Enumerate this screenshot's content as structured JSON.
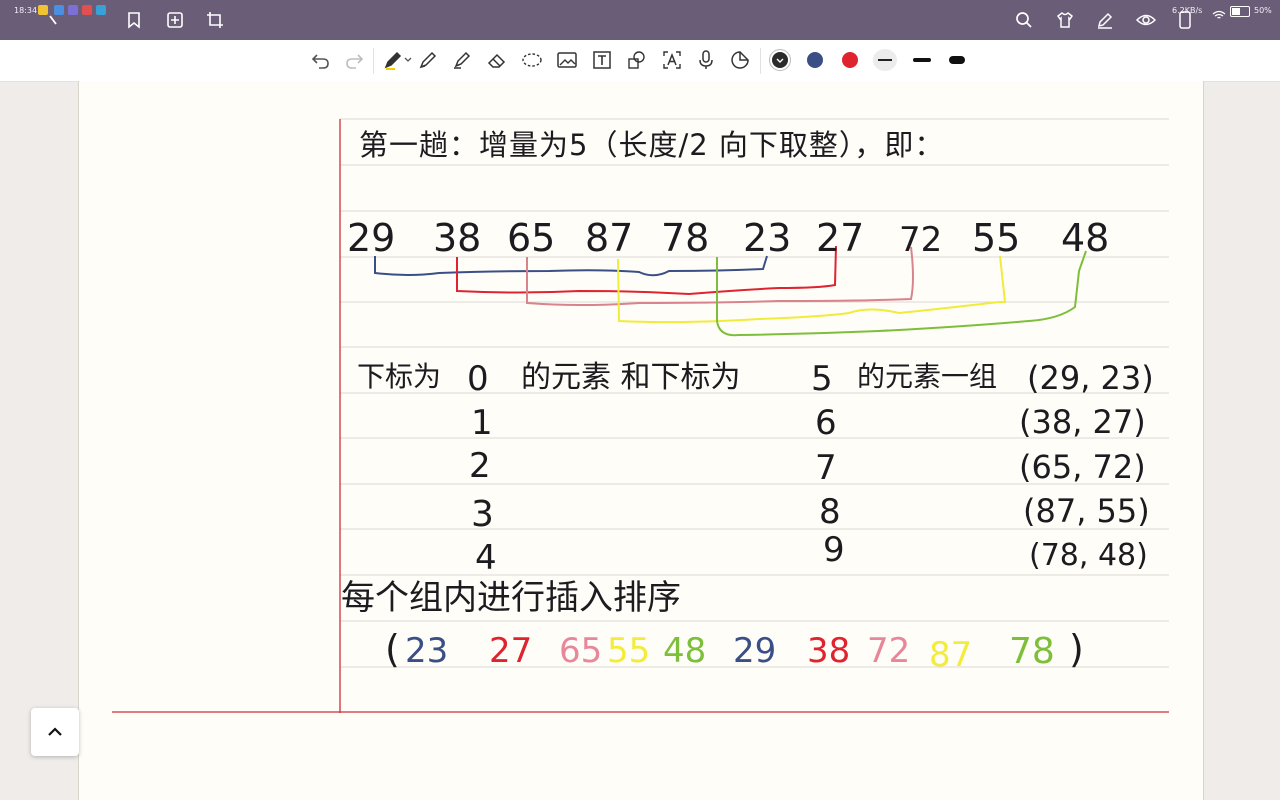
{
  "status_bar": {
    "time": "18:34",
    "battery_percent": "50%",
    "network_speed": "6.2KB/s"
  },
  "title_bar": {
    "icons": [
      "search-icon",
      "shirt-icon",
      "pen-edit-icon",
      "eye-icon",
      "phone-icon"
    ]
  },
  "toolbar": {
    "tools": [
      "undo-icon",
      "redo-icon",
      "pen-icon",
      "fountain-pen-icon",
      "highlighter-icon",
      "eraser-icon",
      "lasso-icon",
      "image-icon",
      "text-box-icon",
      "shape-icon",
      "ocr-text-icon",
      "microphone-icon",
      "sticker-icon"
    ],
    "colors": [
      {
        "name": "black",
        "hex": "#2b2b2b"
      },
      {
        "name": "navy",
        "hex": "#3a4f86"
      },
      {
        "name": "red",
        "hex": "#e0242f"
      }
    ],
    "stroke_widths": [
      "thin",
      "medium",
      "thick"
    ]
  },
  "note": {
    "heading": "第一趟：增量为5（长度/2 向下取整），即：",
    "array": [
      "29",
      "38",
      "65",
      "87",
      "78",
      "23",
      "27",
      "72",
      "55",
      "48"
    ],
    "row_label_prefix": "下标为",
    "row_label_mid": "的元素 和下标为",
    "row_label_suffix": "的元素一组",
    "pairs": [
      {
        "a": "0",
        "b": "5",
        "pair": "(29, 23)"
      },
      {
        "a": "1",
        "b": "6",
        "pair": "(38, 27)"
      },
      {
        "a": "2",
        "b": "7",
        "pair": "(65, 72)"
      },
      {
        "a": "3",
        "b": "8",
        "pair": "(87, 55)"
      },
      {
        "a": "4",
        "b": "9",
        "pair": "(78, 48)"
      }
    ],
    "sort_heading": "每个组内进行插入排序",
    "result_open": "(",
    "result_close": ")",
    "result": [
      {
        "v": "23",
        "color": "#3a4f86"
      },
      {
        "v": "27",
        "color": "#e0242f"
      },
      {
        "v": "65",
        "color": "#e8879a"
      },
      {
        "v": "55",
        "color": "#f4ec3c"
      },
      {
        "v": "48",
        "color": "#7dbf3a"
      },
      {
        "v": "29",
        "color": "#3a4f86"
      },
      {
        "v": "38",
        "color": "#e0242f"
      },
      {
        "v": "72",
        "color": "#e8879a"
      },
      {
        "v": "87",
        "color": "#f4ec3c"
      },
      {
        "v": "78",
        "color": "#7dbf3a"
      }
    ]
  },
  "ink_colors": {
    "group1": "#3a4f86",
    "group2": "#e0242f",
    "group3": "#d9848c",
    "group4": "#f0ec3a",
    "group5": "#7dbf3a",
    "margin_line": "#c9303a",
    "ruled_line": "#d9d6d2"
  }
}
